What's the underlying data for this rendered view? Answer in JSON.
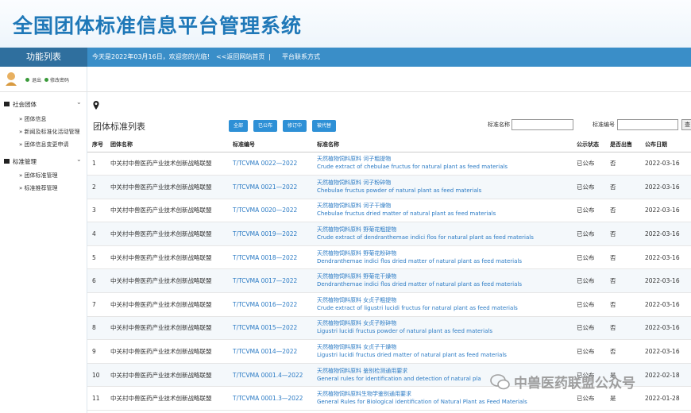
{
  "app": {
    "title": "全国团体标准信息平台管理系统"
  },
  "topbar": {
    "sidebar_title": "功能列表",
    "welcome": "今天是2022年03月16日，欢迎您的光临!",
    "back_link": "<<返回网站首页",
    "separator": "|",
    "contact_link": "平台联系方式"
  },
  "user": {
    "logout": "退出",
    "change_password": "修改密码"
  },
  "sidebar": {
    "groups": [
      {
        "label": "社会团体",
        "items": [
          "» 团体信息",
          "» 新闻及标准化活动管理",
          "» 团体信息变更申请"
        ]
      },
      {
        "label": "标准管理",
        "items": [
          "» 团体标准管理",
          "» 标准推荐管理"
        ]
      }
    ]
  },
  "main": {
    "title": "团体标准列表",
    "buttons": [
      "全部",
      "已公布",
      "修订中",
      "被代替"
    ],
    "filters": {
      "name_label": "标准名称",
      "code_label": "标准编号",
      "search_button": "查"
    },
    "columns": [
      "序号",
      "团体名称",
      "标准编号",
      "标准名称",
      "公示状态",
      "是否出售",
      "公布日期"
    ],
    "rows": [
      {
        "no": "1",
        "org": "中关村中兽医药产业技术创新战略联盟",
        "code": "T/TCVMA 0022—2022",
        "name_zh": "天然植物饲料原料 诃子粗提物",
        "name_en": "Crude extract of chebulae fructus for natural plant as feed materials",
        "status": "已公布",
        "sale": "否",
        "date": "2022-03-16"
      },
      {
        "no": "2",
        "org": "中关村中兽医药产业技术创新战略联盟",
        "code": "T/TCVMA 0021—2022",
        "name_zh": "天然植物饲料原料 诃子粉碎物",
        "name_en": "Chebulae fructus powder of natural plant as feed materials",
        "status": "已公布",
        "sale": "否",
        "date": "2022-03-16"
      },
      {
        "no": "3",
        "org": "中关村中兽医药产业技术创新战略联盟",
        "code": "T/TCVMA 0020—2022",
        "name_zh": "天然植物饲料原料 诃子干燥物",
        "name_en": "Chebulae fructus dried matter of natural plant as feed materials",
        "status": "已公布",
        "sale": "否",
        "date": "2022-03-16"
      },
      {
        "no": "4",
        "org": "中关村中兽医药产业技术创新战略联盟",
        "code": "T/TCVMA 0019—2022",
        "name_zh": "天然植物饲料原料 野菊花粗提物",
        "name_en": "Crude extract of dendranthemae indici flos for natural plant as feed materials",
        "status": "已公布",
        "sale": "否",
        "date": "2022-03-16"
      },
      {
        "no": "5",
        "org": "中关村中兽医药产业技术创新战略联盟",
        "code": "T/TCVMA 0018—2022",
        "name_zh": "天然植物饲料原料 野菊花粉碎物",
        "name_en": "Dendranthemae indici flos dried matter of natural plant as feed materials",
        "status": "已公布",
        "sale": "否",
        "date": "2022-03-16"
      },
      {
        "no": "6",
        "org": "中关村中兽医药产业技术创新战略联盟",
        "code": "T/TCVMA 0017—2022",
        "name_zh": "天然植物饲料原料 野菊花干燥物",
        "name_en": "Dendranthemae indici flos dried matter of natural plant as feed materials",
        "status": "已公布",
        "sale": "否",
        "date": "2022-03-16"
      },
      {
        "no": "7",
        "org": "中关村中兽医药产业技术创新战略联盟",
        "code": "T/TCVMA 0016—2022",
        "name_zh": "天然植物饲料原料 女贞子粗提物",
        "name_en": "Crude extract of ligustri lucidi fructus for natural plant as feed materials",
        "status": "已公布",
        "sale": "否",
        "date": "2022-03-16"
      },
      {
        "no": "8",
        "org": "中关村中兽医药产业技术创新战略联盟",
        "code": "T/TCVMA 0015—2022",
        "name_zh": "天然植物饲料原料 女贞子粉碎物",
        "name_en": "Ligustri lucidi fructus powder of natural plant as feed materials",
        "status": "已公布",
        "sale": "否",
        "date": "2022-03-16"
      },
      {
        "no": "9",
        "org": "中关村中兽医药产业技术创新战略联盟",
        "code": "T/TCVMA 0014—2022",
        "name_zh": "天然植物饲料原料 女贞子干燥物",
        "name_en": "Ligustri lucidi fructus dried matter of natural plant as feed materials",
        "status": "已公布",
        "sale": "否",
        "date": "2022-03-16"
      },
      {
        "no": "10",
        "org": "中关村中兽医药产业技术创新战略联盟",
        "code": "T/TCVMA 0001.4—2022",
        "name_zh": "天然植物饲料原料 鉴别检测通用要求",
        "name_en": "General rules for identification and detection of natural pla",
        "status": "已公布",
        "sale": "是",
        "date": "2022-02-18"
      },
      {
        "no": "11",
        "org": "中关村中兽医药产业技术创新战略联盟",
        "code": "T/TCVMA 0001.3—2022",
        "name_zh": "天然植物饲料原料生物学鉴别通用要求",
        "name_en": "General Rules for Biological identification of Natural Plant as Feed Materials",
        "status": "已公布",
        "sale": "是",
        "date": "2022-01-28"
      }
    ]
  },
  "watermark": {
    "text": "中兽医药联盟公众号"
  },
  "colors": {
    "title_blue": "#1f78b8",
    "bar_blue": "#3a8ec8",
    "sidebar_dark": "#2f6f9e",
    "button_blue": "#2e90d6",
    "link_blue": "#2a7ac4"
  }
}
